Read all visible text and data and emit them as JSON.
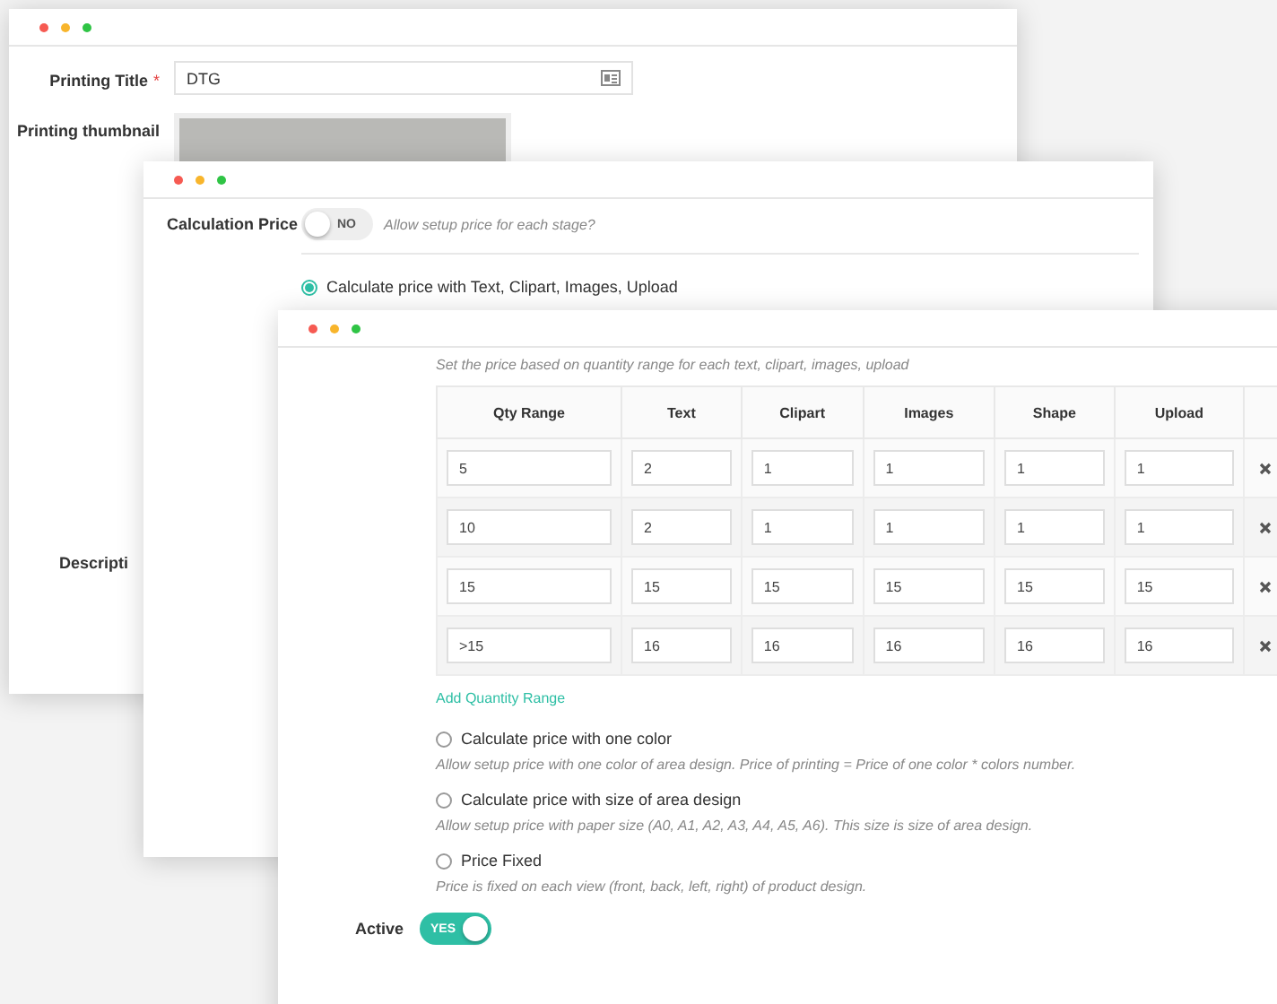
{
  "printing_window": {
    "title_field": {
      "label": "Printing Title",
      "required_mark": "*",
      "value": "DTG"
    },
    "thumbnail_label": "Printing thumbnail",
    "description_label": "Descripti"
  },
  "calculation_window": {
    "label": "Calculation Price",
    "toggle": {
      "on": false,
      "label": "NO"
    },
    "hint": "Allow setup price for each stage?",
    "option": {
      "label": "Calculate price with Text, Clipart, Images, Upload",
      "selected": true
    }
  },
  "pricing_window": {
    "hint": "Set the price based on quantity range for each text, clipart, images, upload",
    "table": {
      "columns": [
        "Qty Range",
        "Text",
        "Clipart",
        "Images",
        "Shape",
        "Upload"
      ],
      "rows": [
        {
          "cells": [
            "5",
            "2",
            "1",
            "1",
            "1",
            "1"
          ]
        },
        {
          "cells": [
            "10",
            "2",
            "1",
            "1",
            "1",
            "1"
          ]
        },
        {
          "cells": [
            "15",
            "15",
            "15",
            "15",
            "15",
            "15"
          ]
        },
        {
          "cells": [
            ">15",
            "16",
            "16",
            "16",
            "16",
            "16"
          ]
        }
      ]
    },
    "add_link": "Add Quantity Range",
    "options": [
      {
        "label": "Calculate price with one color",
        "description": "Allow setup price with one color of area design. Price of printing = Price of one color * colors number.",
        "selected": false
      },
      {
        "label": "Calculate price with size of area design",
        "description": "Allow setup price with paper size (A0, A1, A2, A3, A4, A5, A6). This size is size of area design.",
        "selected": false
      },
      {
        "label": "Price Fixed",
        "description": "Price is fixed on each view (front, back, left, right) of product design.",
        "selected": false
      }
    ],
    "active": {
      "label": "Active",
      "toggle": {
        "on": true,
        "label": "YES"
      }
    }
  }
}
